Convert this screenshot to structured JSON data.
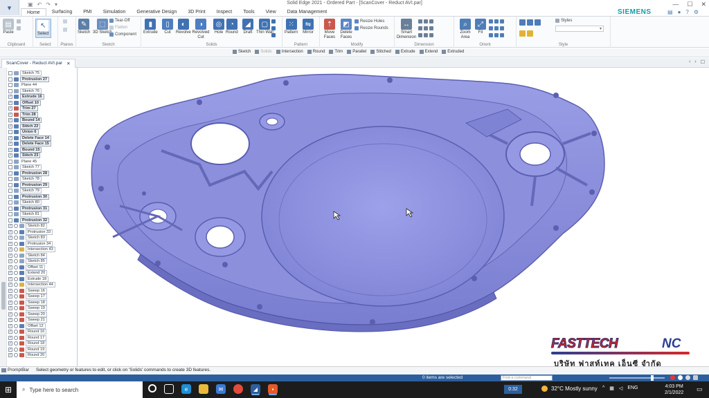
{
  "window": {
    "title": "Solid Edge 2021 - Ordered Part - [ScanCover - Reduct AVI.par]"
  },
  "ribbon_tabs": [
    "Home",
    "Surfacing",
    "PMI",
    "Simulation",
    "Generative Design",
    "3D Print",
    "Inspect",
    "Tools",
    "View",
    "Data Management"
  ],
  "brand": "SIEMENS",
  "ribbon": {
    "clipboard": {
      "label": "Clipboard",
      "paste": "Paste"
    },
    "select": {
      "label": "Select",
      "select": "Select"
    },
    "planes": {
      "label": "Planes"
    },
    "sketch": {
      "label": "Sketch",
      "sketch": "Sketch",
      "sketch3d": "3D Sketch",
      "tearoff": "Tear-Off",
      "flatten": "Flatten",
      "component": "Component"
    },
    "solids": {
      "label": "Solids",
      "extrude": "Extrude",
      "cut": "Cut",
      "revolve": "Revolve",
      "revolved_cut": "Revolved Cut",
      "hole": "Hole",
      "round": "Round",
      "draft": "Draft",
      "thin_wall": "Thin Wall"
    },
    "pattern": {
      "label": "Pattern",
      "pattern": "Pattern",
      "mirror": "Mirror"
    },
    "modify": {
      "label": "Modify",
      "move_faces": "Move Faces",
      "delete_faces": "Delete Faces",
      "resize_holes": "Resize Holes",
      "resize_rounds": "Resize Rounds"
    },
    "dimension": {
      "label": "Dimension",
      "smart_dimension": "Smart Dimension"
    },
    "orient": {
      "label": "Orient",
      "zoom_area": "Zoom Area",
      "fit": "Fit"
    },
    "style": {
      "label": "Style",
      "styles": "Styles"
    }
  },
  "command_bar": [
    "Sketch",
    "Solids",
    "Intersection",
    "Round",
    "Trim",
    "Parallel",
    "Stitched",
    "Extrude",
    "Extend",
    "Extruded"
  ],
  "doc_tab": {
    "name": "ScanCover - Reduct AVI.par"
  },
  "pathfinder": [
    {
      "label": "Sketch 75",
      "cb": "",
      "icon": "sketch",
      "style": "boxed"
    },
    {
      "label": "Protrusion 27",
      "cb": "",
      "icon": "feat",
      "style": "bold"
    },
    {
      "label": "Plane 44",
      "cb": "",
      "icon": "sketch",
      "style": ""
    },
    {
      "label": "Sketch 76",
      "cb": "",
      "icon": "sketch",
      "style": "boxed"
    },
    {
      "label": "Extrude 16",
      "cb": "✓",
      "icon": "feat",
      "style": "bold"
    },
    {
      "label": "Offset 10",
      "cb": "✓",
      "icon": "feat",
      "style": "bold"
    },
    {
      "label": "Trim 27",
      "cb": "✓",
      "icon": "red",
      "style": "bold"
    },
    {
      "label": "Trim 28",
      "cb": "✓",
      "icon": "red",
      "style": "bold"
    },
    {
      "label": "Bound 14",
      "cb": "✓",
      "icon": "feat",
      "style": "bold"
    },
    {
      "label": "Stitch 22",
      "cb": "✓",
      "icon": "feat",
      "style": "bold"
    },
    {
      "label": "Union 6",
      "cb": "",
      "icon": "feat",
      "style": "bold"
    },
    {
      "label": "Delete Face 14",
      "cb": "✓",
      "icon": "feat",
      "style": "bold"
    },
    {
      "label": "Delete Face 15",
      "cb": "✓",
      "icon": "feat",
      "style": "bold"
    },
    {
      "label": "Bound 15",
      "cb": "✓",
      "icon": "feat",
      "style": "bold"
    },
    {
      "label": "Stitch 23",
      "cb": "✓",
      "icon": "feat",
      "style": "bold"
    },
    {
      "label": "Plane 45",
      "cb": "",
      "icon": "sketch",
      "style": ""
    },
    {
      "label": "Sketch 77",
      "cb": "",
      "icon": "sketch",
      "style": "boxed"
    },
    {
      "label": "Protrusion 28",
      "cb": "",
      "icon": "feat",
      "style": "bold"
    },
    {
      "label": "Sketch 78",
      "cb": "",
      "icon": "sketch",
      "style": "boxed"
    },
    {
      "label": "Protrusion 29",
      "cb": "",
      "icon": "feat",
      "style": "bold"
    },
    {
      "label": "Sketch 79",
      "cb": "",
      "icon": "sketch",
      "style": "boxed"
    },
    {
      "label": "Protrusion 30",
      "cb": "",
      "icon": "feat",
      "style": "bold"
    },
    {
      "label": "Sketch 80",
      "cb": "",
      "icon": "sketch",
      "style": "boxed"
    },
    {
      "label": "Protrusion 31",
      "cb": "",
      "icon": "feat",
      "style": "bold"
    },
    {
      "label": "Sketch 81",
      "cb": "",
      "icon": "sketch",
      "style": "boxed"
    },
    {
      "label": "Protrusion 32",
      "cb": "",
      "icon": "feat",
      "style": "bold"
    },
    {
      "label": "Sketch 82",
      "cb": "✓",
      "icon": "sketch",
      "style": "boxed"
    },
    {
      "label": "Protrusion 33",
      "cb": "✓",
      "icon": "feat",
      "style": "boxed"
    },
    {
      "label": "Sketch 83",
      "cb": "✓",
      "icon": "sketch",
      "style": "boxed"
    },
    {
      "label": "Protrusion 34",
      "cb": "✓",
      "icon": "feat",
      "style": "boxed"
    },
    {
      "label": "Intersection 43",
      "cb": "✓",
      "icon": "yel",
      "style": "boxed"
    },
    {
      "label": "Sketch 84",
      "cb": "✓",
      "icon": "sketch",
      "style": "boxed"
    },
    {
      "label": "Sketch 85",
      "cb": "✓",
      "icon": "sketch",
      "style": "boxed"
    },
    {
      "label": "Offset 11",
      "cb": "✓",
      "icon": "feat",
      "style": "boxed"
    },
    {
      "label": "Extend 20",
      "cb": "✓",
      "icon": "feat",
      "style": "boxed"
    },
    {
      "label": "Extrude 18",
      "cb": "✓",
      "icon": "feat",
      "style": "boxed"
    },
    {
      "label": "Intersection 44",
      "cb": "✓",
      "icon": "yel",
      "style": "boxed"
    },
    {
      "label": "Sweep 16",
      "cb": "✓",
      "icon": "red",
      "style": "boxed"
    },
    {
      "label": "Sweep 17",
      "cb": "✓",
      "icon": "red",
      "style": "boxed"
    },
    {
      "label": "Sweep 18",
      "cb": "✓",
      "icon": "red",
      "style": "boxed"
    },
    {
      "label": "Sweep 19",
      "cb": "✓",
      "icon": "red",
      "style": "boxed"
    },
    {
      "label": "Sweep 20",
      "cb": "✓",
      "icon": "red",
      "style": "boxed"
    },
    {
      "label": "Sweep 21",
      "cb": "✓",
      "icon": "red",
      "style": "boxed"
    },
    {
      "label": "Offset 12",
      "cb": "✓",
      "icon": "feat",
      "style": "boxed"
    },
    {
      "label": "Round 16",
      "cb": "✓",
      "icon": "red",
      "style": "boxed"
    },
    {
      "label": "Round 17",
      "cb": "✓",
      "icon": "red",
      "style": "boxed"
    },
    {
      "label": "Round 18",
      "cb": "✓",
      "icon": "red",
      "style": "boxed"
    },
    {
      "label": "Round 19",
      "cb": "✓",
      "icon": "red",
      "style": "boxed"
    },
    {
      "label": "Round 20",
      "cb": "✓",
      "icon": "red",
      "style": "boxed"
    }
  ],
  "status": {
    "prompt_label": "PromptBar",
    "prompt": "Select geometry or features to edit, or click on 'Solids' commands to create 3D features.",
    "selection": "0 items are selected",
    "find_placeholder": "Find a command"
  },
  "watermark": {
    "top": "FASTTECH",
    "nc": "NC",
    "bottom": "บริษัท ฟาสท์เทค เอ็นซี จำกัด"
  },
  "taskbar": {
    "search_placeholder": "Type here to search",
    "timer": "0:32",
    "weather": "32°C  Mostly sunny",
    "lang": "ENG",
    "time": "4:03 PM",
    "date": "2/1/2022"
  },
  "colors": {
    "part": "#8b8fdb",
    "part_dark": "#5c5fb0",
    "accent": "#2d5f9e",
    "brand": "#139aa6"
  }
}
